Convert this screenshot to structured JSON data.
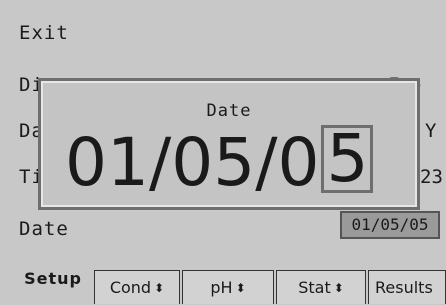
{
  "menu": {
    "exit": "Exit",
    "row2": "Di",
    "row3": "Da",
    "row4": "Ti",
    "row5": "Date"
  },
  "right": {
    "row2": "ne",
    "row3": "Y",
    "row4": "23"
  },
  "date_value": "01/05/05",
  "popup": {
    "title": "Date",
    "date_prefix": "01/05/0",
    "cursor_digit": "5"
  },
  "tabs": [
    {
      "label": "Setup"
    },
    {
      "label": "Cond"
    },
    {
      "label": "pH"
    },
    {
      "label": "Stat"
    },
    {
      "label": "Results"
    }
  ],
  "icons": {
    "updown": "updown-arrow-icon"
  }
}
